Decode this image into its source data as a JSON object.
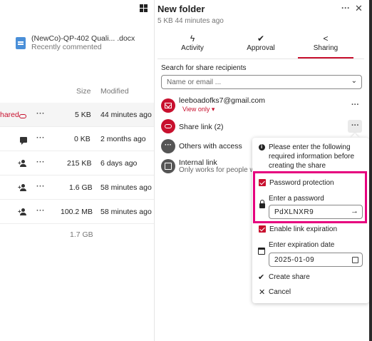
{
  "recent": {
    "file_name": "(NewCo)-QP-402 Quali... .docx",
    "subtitle": "Recently commented"
  },
  "columns": {
    "size": "Size",
    "modified": "Modified"
  },
  "rows": [
    {
      "shared_label": "hared",
      "size": "5 KB",
      "modified": "44 minutes ago",
      "icon": "link-icon"
    },
    {
      "size": "0 KB",
      "modified": "2 months ago",
      "icon": "comment-icon"
    },
    {
      "size": "215 KB",
      "modified": "6 days ago",
      "icon": "add-user-icon"
    },
    {
      "size": "1.6 GB",
      "modified": "58 minutes ago",
      "icon": "add-user-icon"
    },
    {
      "size": "100.2 MB",
      "modified": "58 minutes ago",
      "icon": "add-user-icon"
    }
  ],
  "total_size": "1.7 GB",
  "sidebar": {
    "title": "New folder",
    "subtitle": "5 KB 44 minutes ago",
    "tabs": [
      {
        "label": "Activity",
        "icon": "activity-icon"
      },
      {
        "label": "Approval",
        "icon": "check-icon"
      },
      {
        "label": "Sharing",
        "icon": "share-icon"
      }
    ],
    "active_tab": "Sharing",
    "search_label": "Search for share recipients",
    "search_placeholder": "Name or email ...",
    "entries": {
      "email_title": "leeboadofks7@gmail.com",
      "email_perm": "View only",
      "share_link": "Share link (2)",
      "others_access": "Others with access",
      "internal_link": "Internal link",
      "internal_sub": "Only works for people w"
    }
  },
  "popup": {
    "info": "Please enter the following required information before creating the share",
    "password_protection": "Password protection",
    "enter_password": "Enter a password",
    "password_value": "PdXLNXR9",
    "enable_expiration": "Enable link expiration",
    "enter_expiration": "Enter expiration date",
    "expiration_value": "2025-01-09",
    "create_share": "Create share",
    "cancel": "Cancel"
  },
  "colors": {
    "accent": "#c8102e",
    "highlight_box": "#e6007e"
  }
}
